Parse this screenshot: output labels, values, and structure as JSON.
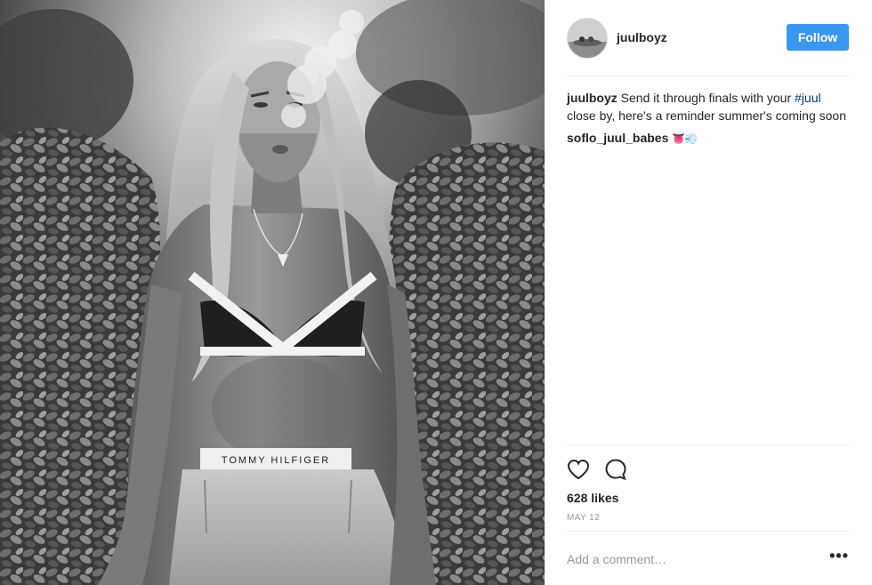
{
  "post": {
    "username": "juulboyz",
    "follow_label": "Follow",
    "caption": {
      "user": "juulboyz",
      "text_before": "Send it through finals with your",
      "hashtag": "#juul",
      "text_after": "close by, here's a reminder summer's coming soon"
    },
    "comments": [
      {
        "user": "soflo_juul_babes",
        "text": "👅💨"
      }
    ],
    "likes": "628 likes",
    "date": "MAY 12",
    "comment_placeholder": "Add a comment…",
    "more_options": "•••"
  },
  "photo": {
    "waistband_text": "TOMMY HILFIGER"
  },
  "icons": {
    "like": "heart-icon",
    "comment": "comment-bubble-icon",
    "more": "more-options-icon"
  },
  "colors": {
    "follow_button": "#3897f0",
    "hashtag": "#003569",
    "text": "#262626",
    "muted": "#999999",
    "divider": "#efefef"
  }
}
